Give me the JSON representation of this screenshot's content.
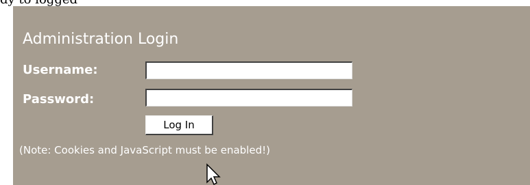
{
  "header": {
    "fragment_text": "dy to logged"
  },
  "login": {
    "title": "Administration Login",
    "username_label": "Username:",
    "password_label": "Password:",
    "username_value": "",
    "password_value": "",
    "submit_label": "Log In",
    "note": "(Note: Cookies and JavaScript must be enabled!)"
  },
  "colors": {
    "panel_background": "#a69d90",
    "text": "#ffffff"
  },
  "icons": {
    "cursor": "mouse-pointer-icon"
  }
}
